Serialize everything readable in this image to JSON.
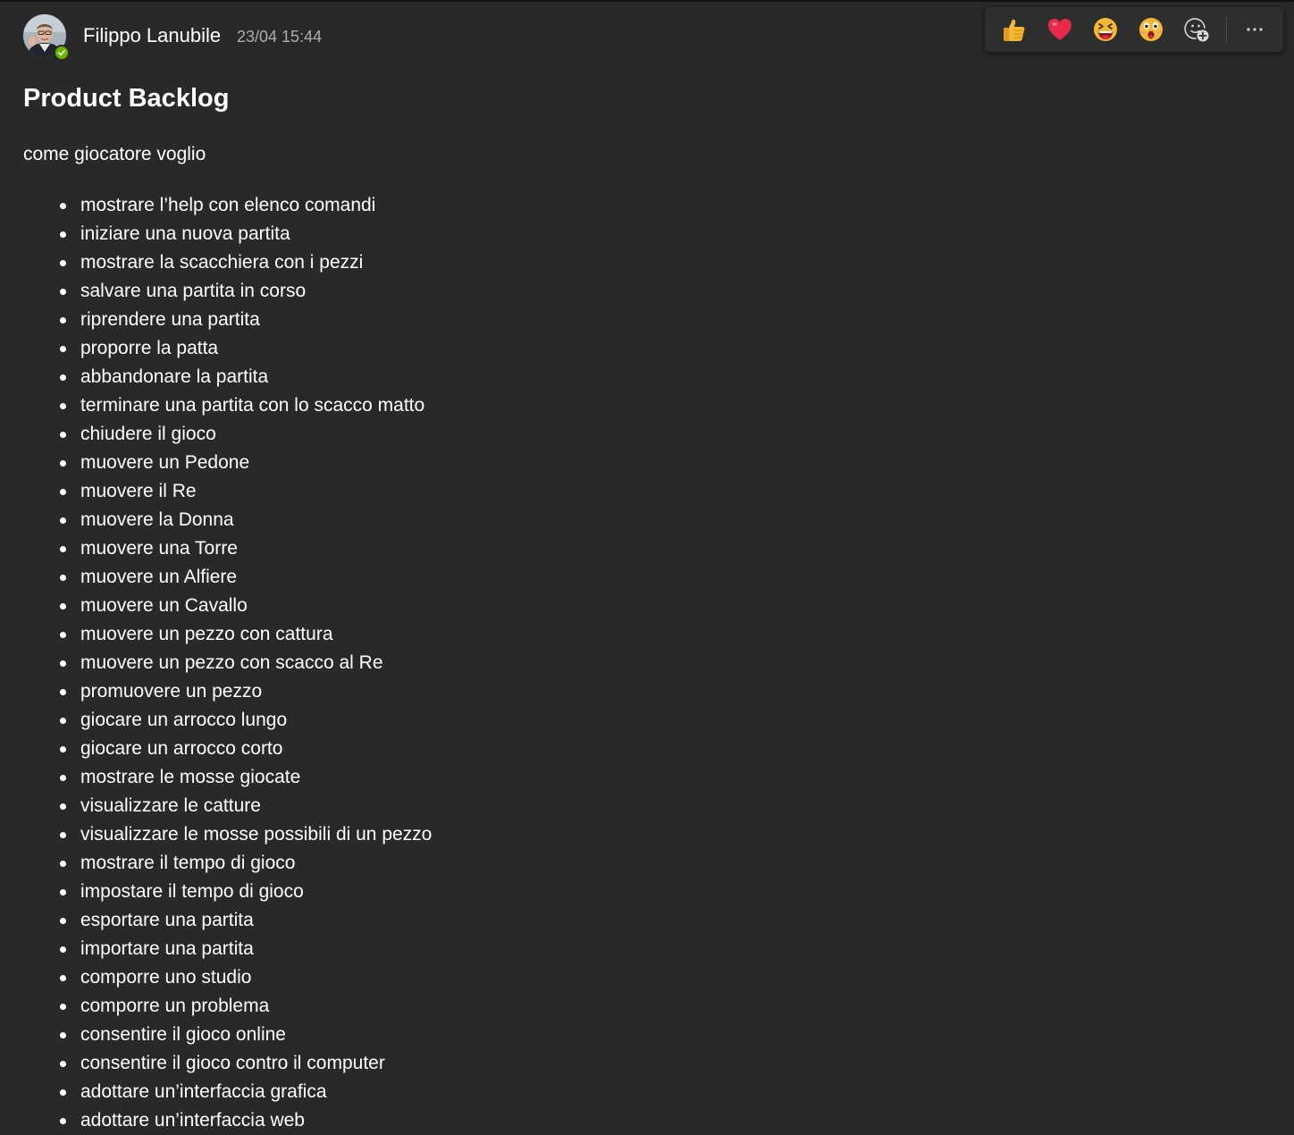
{
  "message": {
    "author": "Filippo Lanubile",
    "timestamp": "23/04 15:44",
    "title": "Product Backlog",
    "intro": "come giocatore voglio",
    "items": [
      "mostrare l’help con elenco comandi",
      "iniziare una nuova partita",
      "mostrare la scacchiera con i pezzi",
      "salvare una partita in corso",
      "riprendere una partita",
      "proporre la patta",
      "abbandonare la partita",
      "terminare una partita con lo scacco matto",
      "chiudere il gioco",
      "muovere un Pedone",
      "muovere il Re",
      "muovere la Donna",
      "muovere una Torre",
      "muovere un Alfiere",
      "muovere un Cavallo",
      "muovere un pezzo con cattura",
      "muovere un pezzo con scacco al Re",
      "promuovere un pezzo",
      "giocare un arrocco lungo",
      "giocare un arrocco corto",
      "mostrare le mosse giocate",
      "visualizzare le catture",
      "visualizzare le mosse possibili di un pezzo",
      "mostrare il tempo di gioco",
      "impostare il tempo di gioco",
      "esportare una partita",
      "importare una partita",
      "comporre uno studio",
      "comporre un problema",
      "consentire il gioco online",
      "consentire il gioco contro il computer",
      "adottare un’interfaccia grafica",
      "adottare un’interfaccia web"
    ]
  },
  "reactions": {
    "items": [
      {
        "name": "like",
        "icon": "thumbs-up-icon"
      },
      {
        "name": "heart",
        "icon": "heart-icon"
      },
      {
        "name": "laugh",
        "icon": "laugh-icon"
      },
      {
        "name": "surprised",
        "icon": "surprised-icon"
      },
      {
        "name": "add-reaction",
        "icon": "add-reaction-icon"
      },
      {
        "name": "more-options",
        "icon": "more-icon"
      }
    ]
  },
  "colors": {
    "background": "#292929",
    "text": "#ffffff",
    "timestamp": "#adadad",
    "presence": "#6bb700",
    "reaction_bar": "#2e2e2e"
  }
}
